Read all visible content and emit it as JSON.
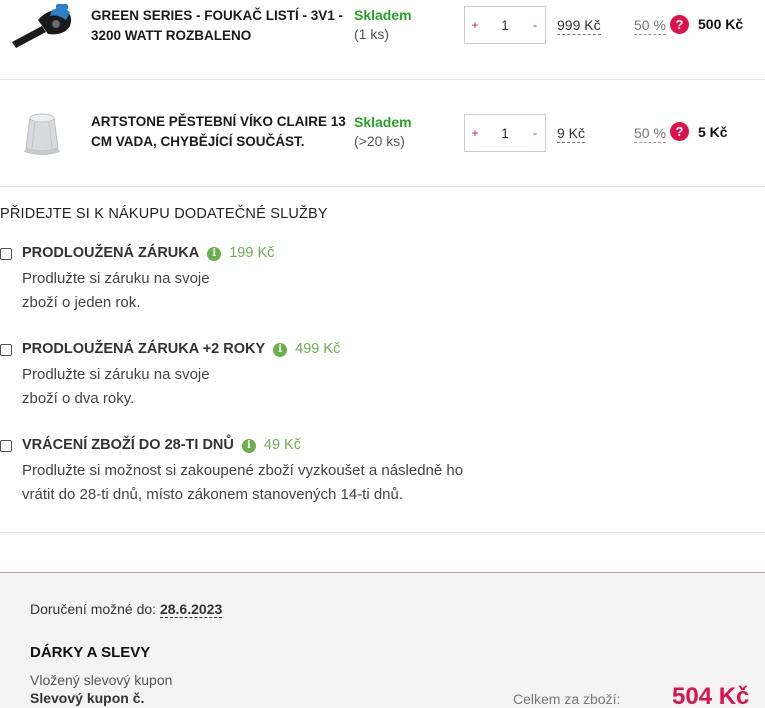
{
  "items": [
    {
      "name": "GREEN SERIES - FOUKAČ LISTÍ - 3V1 - 3200 WATT ROZBALENO",
      "stock_status": "Skladem",
      "stock_count": "(1 ks)",
      "qty_plus": "+",
      "qty_minus": "-",
      "quantity": "1",
      "unit_price": "999 Kč",
      "discount": "50 %",
      "help_icon": "?",
      "total": "500 Kč",
      "image_icon": "leaf-blower-icon"
    },
    {
      "name": "ARTSTONE PĚSTEBNÍ VÍKO CLAIRE 13 CM VADA, CHYBĚJÍCÍ SOUČÁST.",
      "stock_status": "Skladem",
      "stock_count": "(>20 ks)",
      "qty_plus": "+",
      "qty_minus": "-",
      "quantity": "1",
      "unit_price": "9 Kč",
      "discount": "50 %",
      "help_icon": "?",
      "total": "5 Kč",
      "image_icon": "plant-cover-icon"
    }
  ],
  "services": {
    "title": "PŘIDEJTE SI K NÁKUPU DODATEČNÉ SLUŽBY",
    "info_icon": "i",
    "items": [
      {
        "title": "PRODLOUŽENÁ ZÁRUKA",
        "price": "199 Kč",
        "desc_line1": "Prodlužte si záruku na svoje",
        "desc_line2": "zboží o jeden rok."
      },
      {
        "title": "PRODLOUŽENÁ ZÁRUKA +2 ROKY",
        "price": "499 Kč",
        "desc_line1": "Prodlužte si záruku na svoje",
        "desc_line2": "zboží o dva roky."
      },
      {
        "title": "VRÁCENÍ ZBOŽÍ DO 28-TI DNŮ",
        "price": "49 Kč",
        "desc_line1": "Prodlužte si možnost si zakoupené zboží vyzkoušet a následně ho",
        "desc_line2": "vrátit do 28-ti dnů, místo zákonem stanovených 14-ti dnů."
      }
    ]
  },
  "footer": {
    "delivery_label": "Doručení možné do:",
    "delivery_date": "28.6.2023",
    "gifts_title": "DÁRKY A SLEVY",
    "coupon_label": "Vložený slevový kupon",
    "coupon_value": "Slevový kupon č.",
    "sum_label": "Celkem za zboží:",
    "sum_value": "504 Kč"
  },
  "colors": {
    "accent": "#e0104c",
    "stock_ok": "#24a524",
    "service_price": "#6ab04c"
  }
}
